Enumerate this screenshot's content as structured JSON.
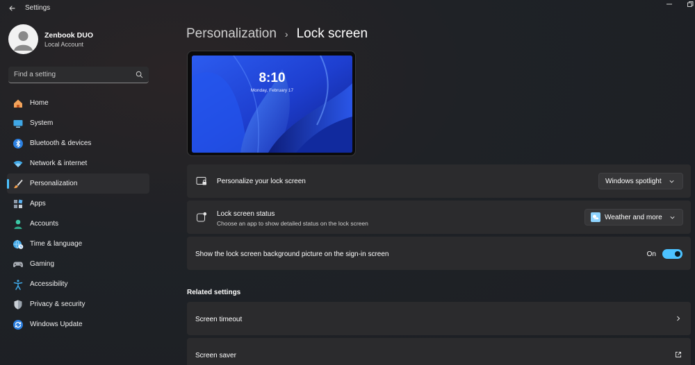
{
  "app": {
    "title": "Settings"
  },
  "profile": {
    "name": "Zenbook DUO",
    "account_type": "Local Account"
  },
  "search": {
    "placeholder": "Find a setting"
  },
  "sidebar": {
    "items": [
      {
        "label": "Home",
        "icon": "home-icon"
      },
      {
        "label": "System",
        "icon": "system-icon"
      },
      {
        "label": "Bluetooth & devices",
        "icon": "bluetooth-icon"
      },
      {
        "label": "Network & internet",
        "icon": "wifi-icon"
      },
      {
        "label": "Personalization",
        "icon": "brush-icon",
        "active": true
      },
      {
        "label": "Apps",
        "icon": "apps-icon"
      },
      {
        "label": "Accounts",
        "icon": "accounts-icon"
      },
      {
        "label": "Time & language",
        "icon": "globe-clock-icon"
      },
      {
        "label": "Gaming",
        "icon": "gamepad-icon"
      },
      {
        "label": "Accessibility",
        "icon": "accessibility-icon"
      },
      {
        "label": "Privacy & security",
        "icon": "shield-icon"
      },
      {
        "label": "Windows Update",
        "icon": "update-icon"
      }
    ]
  },
  "breadcrumb": {
    "parent": "Personalization",
    "separator": "›",
    "current": "Lock screen"
  },
  "preview": {
    "time": "8:10",
    "date": "Monday, February 17"
  },
  "settings": {
    "personalize": {
      "title": "Personalize your lock screen",
      "value": "Windows spotlight"
    },
    "status": {
      "title": "Lock screen status",
      "description": "Choose an app to show detailed status on the lock screen",
      "value": "Weather and more"
    },
    "signin_background": {
      "title": "Show the lock screen background picture on the sign-in screen",
      "state_label": "On",
      "enabled": true
    }
  },
  "related": {
    "heading": "Related settings",
    "items": [
      {
        "label": "Screen timeout",
        "icon": "chevron-right-icon"
      },
      {
        "label": "Screen saver",
        "icon": "open-external-icon"
      }
    ]
  },
  "colors": {
    "accent": "#4cc2ff",
    "card": "#2b2b2d",
    "active_nav": "#2d2d30"
  }
}
